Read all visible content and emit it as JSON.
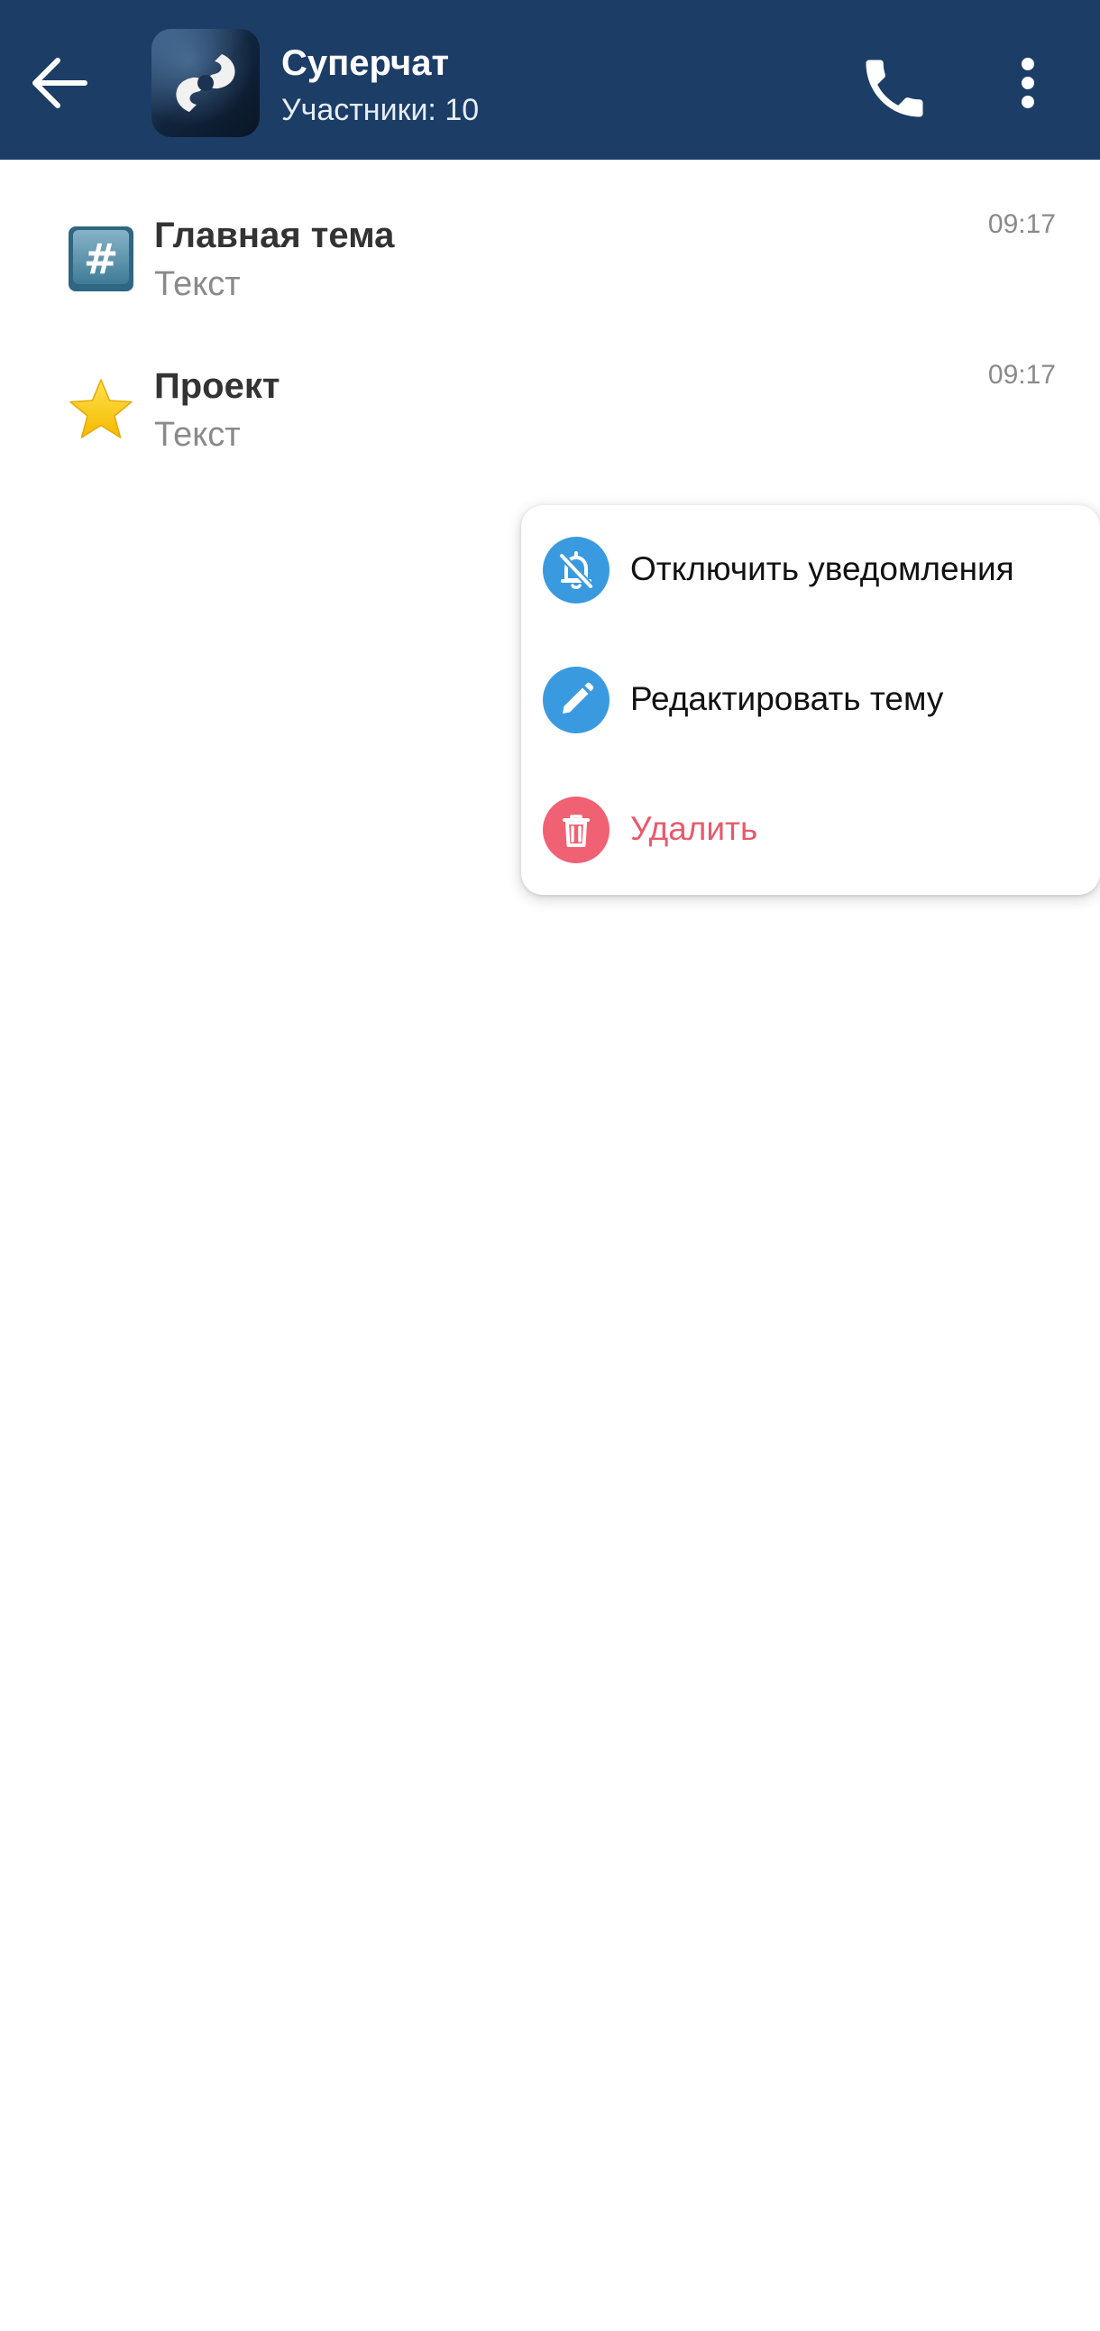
{
  "header": {
    "title": "Суперчат",
    "subtitle": "Участники: 10",
    "back_icon": "arrow-left-icon",
    "call_icon": "phone-icon",
    "more_icon": "more-vertical-icon",
    "background_color": "#1c3d66"
  },
  "topics": [
    {
      "icon": "hash-keycap-icon",
      "title": "Главная тема",
      "preview": "Текст",
      "time": "09:17"
    },
    {
      "icon": "star-icon",
      "title": "Проект",
      "preview": "Текст",
      "time": "09:17"
    }
  ],
  "context_menu": {
    "items": [
      {
        "label": "Отключить уведомления",
        "icon": "bell-off-icon",
        "icon_color": "#3a9ae0",
        "danger": false
      },
      {
        "label": "Редактировать тему",
        "icon": "pencil-icon",
        "icon_color": "#3a9ae0",
        "danger": false
      },
      {
        "label": "Удалить",
        "icon": "trash-icon",
        "icon_color": "#f06173",
        "danger": true
      }
    ]
  }
}
